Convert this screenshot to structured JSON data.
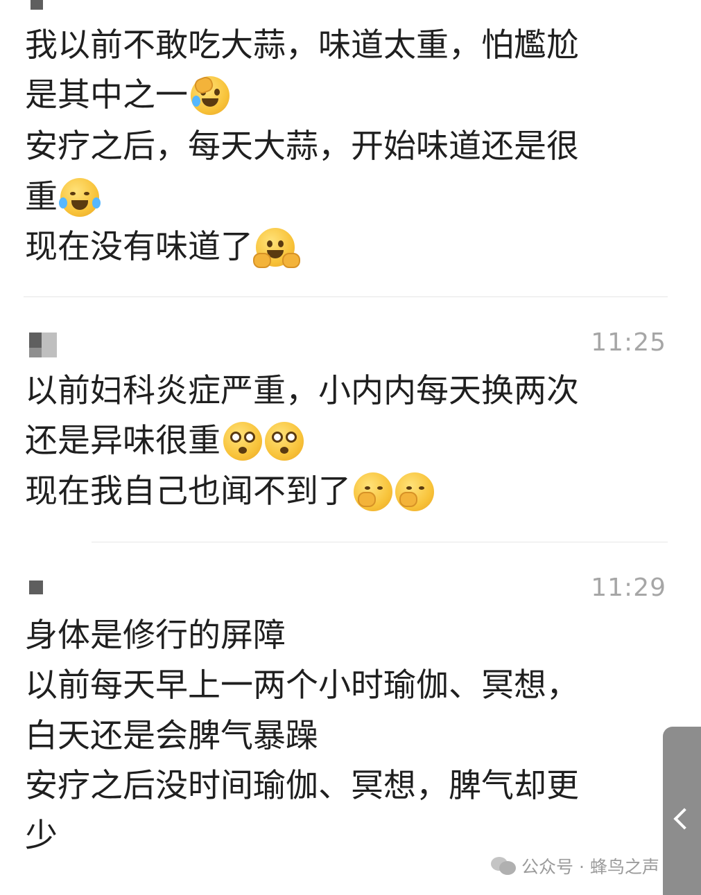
{
  "messages": [
    {
      "time": "",
      "lines": [
        {
          "text": "我以前不敢吃大蒜，味道太重，怕尷尬",
          "emojis": []
        },
        {
          "text": "是其中之一",
          "emojis": [
            "face-palm-emoji"
          ]
        },
        {
          "text": "安疗之后，每天大蒜，开始味道还是很",
          "emojis": []
        },
        {
          "text": "重",
          "emojis": [
            "laugh-cry-emoji"
          ]
        },
        {
          "text": "现在没有味道了",
          "emojis": [
            "happy-hands-emoji"
          ]
        }
      ]
    },
    {
      "time": "11:25",
      "lines": [
        {
          "text": "以前妇科炎症严重，小内内每天换两次",
          "emojis": []
        },
        {
          "text": "还是异味很重",
          "emojis": [
            "dizzy-emoji",
            "dizzy-emoji"
          ]
        },
        {
          "text": "现在我自己也闻不到了",
          "emojis": [
            "shy-emoji",
            "shy-emoji"
          ]
        }
      ]
    },
    {
      "time": "11:29",
      "lines": [
        {
          "text": "身体是修行的屏障",
          "emojis": []
        },
        {
          "text": "以前每天早上一两个小时瑜伽、冥想，",
          "emojis": []
        },
        {
          "text": "白天还是会脾气暴躁",
          "emojis": []
        },
        {
          "text": "安疗之后没时间瑜伽、冥想，脾气却更",
          "emojis": []
        },
        {
          "text": "少",
          "emojis": []
        }
      ]
    }
  ],
  "watermark": {
    "text": "公众号 · 蜂鸟之声",
    "icon": "wechat-icon"
  },
  "side_tab": {
    "icon": "chevron-left-icon"
  }
}
